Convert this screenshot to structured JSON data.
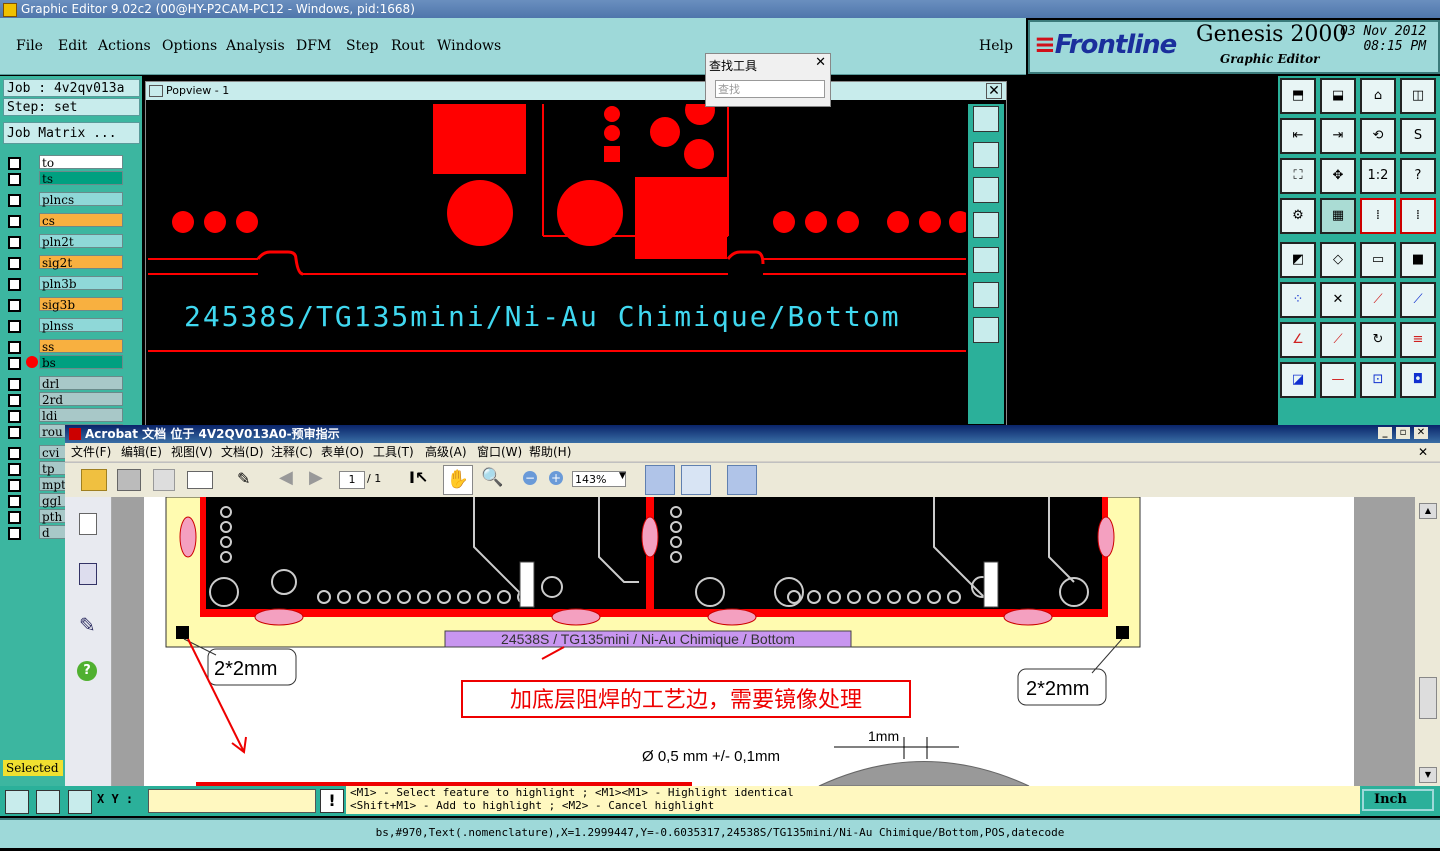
{
  "window_title": "Graphic Editor 9.02c2 (00@HY-P2CAM-PC12 - Windows, pid:1668)",
  "menu": [
    "File",
    "Edit",
    "Actions",
    "Options",
    "Analysis",
    "DFM",
    "Step",
    "Rout",
    "Windows"
  ],
  "help_label": "Help",
  "brand": {
    "logo": "Frontline",
    "product": "Genesis 2000",
    "subtitle": "Graphic Editor",
    "date": "03 Nov 2012",
    "time": "08:15 PM"
  },
  "job": {
    "job_label": "Job : 4v2qv013a",
    "step_label": "Step: set",
    "matrix_label": "Job Matrix ..."
  },
  "layers": [
    {
      "name": "to",
      "color": "#ffffff"
    },
    {
      "name": "ts",
      "color": "#00a080"
    },
    {
      "name": "plncs",
      "color": "#8fd8d8"
    },
    {
      "name": "cs",
      "color": "#f8b040"
    },
    {
      "name": "pln2t",
      "color": "#8fd8d8"
    },
    {
      "name": "sig2t",
      "color": "#f8b040"
    },
    {
      "name": "pln3b",
      "color": "#8fd8d8"
    },
    {
      "name": "sig3b",
      "color": "#f8b040"
    },
    {
      "name": "plnss",
      "color": "#8fd8d8"
    },
    {
      "name": "ss",
      "color": "#f8b040"
    },
    {
      "name": "bs",
      "color": "#00a080"
    },
    {
      "name": "drl",
      "color": "#a8c8c8"
    },
    {
      "name": "2rd",
      "color": "#a8c8c8"
    },
    {
      "name": "ldi",
      "color": "#a8c8c8"
    },
    {
      "name": "rou",
      "color": "#a8c8c8"
    },
    {
      "name": "cvi",
      "color": "#a8c8c8"
    },
    {
      "name": "tp",
      "color": "#a8c8c8"
    },
    {
      "name": "mpt",
      "color": "#a8c8c8"
    },
    {
      "name": "ggl",
      "color": "#a8c8c8"
    },
    {
      "name": "pth",
      "color": "#a8c8c8"
    },
    {
      "name": "d",
      "color": "#a8c8c8"
    }
  ],
  "selected_label": "Selected",
  "popview": {
    "title": "Popview - 1",
    "text": "24538S/TG135mini/Ni-Au Chimique/Bottom"
  },
  "find_tool": {
    "title": "查找工具",
    "placeholder": "查找"
  },
  "right_tools": [
    "1:2",
    "?"
  ],
  "acrobat": {
    "title": "Acrobat 文档 位于 4V2QV013A0-预审指示",
    "menu": [
      "文件(F)",
      "编辑(E)",
      "视图(V)",
      "文档(D)",
      "注释(C)",
      "表单(O)",
      "工具(T)",
      "高级(A)",
      "窗口(W)",
      "帮助(H)"
    ],
    "page_num": "1",
    "page_total": "/ 1",
    "zoom": "143%",
    "doc": {
      "label_bar": "24538S /  TG135mini / Ni-Au Chimique / Bottom",
      "callout_left": "2*2mm",
      "callout_right": "2*2mm",
      "note": "加底层阻焊的工艺边，需要镜像处理",
      "dimension_1": "1mm",
      "dimension_2": "Ø 0,5 mm +/- 0,1mm"
    }
  },
  "bottom": {
    "xy_label": "X Y :",
    "hint_line1": "<M1> - Select feature to highlight ; <M1><M1> - Highlight identical",
    "hint_line2": "<Shift+M1> - Add to highlight ; <M2> - Cancel highlight",
    "units": "Inch"
  },
  "status_line": "bs,#970,Text(.nomenclature),X=1.2999447,Y=-0.6035317,24538S/TG135mini/Ni-Au Chimique/Bottom,POS,datecode"
}
